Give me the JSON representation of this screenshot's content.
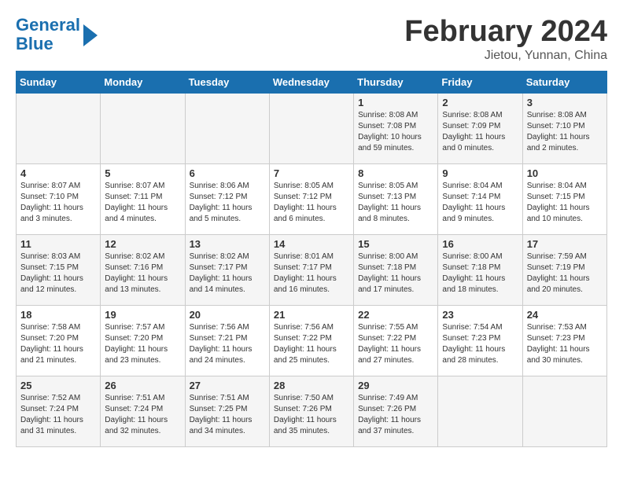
{
  "header": {
    "logo_line1": "General",
    "logo_line2": "Blue",
    "month_title": "February 2024",
    "location": "Jietou, Yunnan, China"
  },
  "days_of_week": [
    "Sunday",
    "Monday",
    "Tuesday",
    "Wednesday",
    "Thursday",
    "Friday",
    "Saturday"
  ],
  "weeks": [
    [
      {
        "day": "",
        "info": ""
      },
      {
        "day": "",
        "info": ""
      },
      {
        "day": "",
        "info": ""
      },
      {
        "day": "",
        "info": ""
      },
      {
        "day": "1",
        "info": "Sunrise: 8:08 AM\nSunset: 7:08 PM\nDaylight: 10 hours\nand 59 minutes."
      },
      {
        "day": "2",
        "info": "Sunrise: 8:08 AM\nSunset: 7:09 PM\nDaylight: 11 hours\nand 0 minutes."
      },
      {
        "day": "3",
        "info": "Sunrise: 8:08 AM\nSunset: 7:10 PM\nDaylight: 11 hours\nand 2 minutes."
      }
    ],
    [
      {
        "day": "4",
        "info": "Sunrise: 8:07 AM\nSunset: 7:10 PM\nDaylight: 11 hours\nand 3 minutes."
      },
      {
        "day": "5",
        "info": "Sunrise: 8:07 AM\nSunset: 7:11 PM\nDaylight: 11 hours\nand 4 minutes."
      },
      {
        "day": "6",
        "info": "Sunrise: 8:06 AM\nSunset: 7:12 PM\nDaylight: 11 hours\nand 5 minutes."
      },
      {
        "day": "7",
        "info": "Sunrise: 8:05 AM\nSunset: 7:12 PM\nDaylight: 11 hours\nand 6 minutes."
      },
      {
        "day": "8",
        "info": "Sunrise: 8:05 AM\nSunset: 7:13 PM\nDaylight: 11 hours\nand 8 minutes."
      },
      {
        "day": "9",
        "info": "Sunrise: 8:04 AM\nSunset: 7:14 PM\nDaylight: 11 hours\nand 9 minutes."
      },
      {
        "day": "10",
        "info": "Sunrise: 8:04 AM\nSunset: 7:15 PM\nDaylight: 11 hours\nand 10 minutes."
      }
    ],
    [
      {
        "day": "11",
        "info": "Sunrise: 8:03 AM\nSunset: 7:15 PM\nDaylight: 11 hours\nand 12 minutes."
      },
      {
        "day": "12",
        "info": "Sunrise: 8:02 AM\nSunset: 7:16 PM\nDaylight: 11 hours\nand 13 minutes."
      },
      {
        "day": "13",
        "info": "Sunrise: 8:02 AM\nSunset: 7:17 PM\nDaylight: 11 hours\nand 14 minutes."
      },
      {
        "day": "14",
        "info": "Sunrise: 8:01 AM\nSunset: 7:17 PM\nDaylight: 11 hours\nand 16 minutes."
      },
      {
        "day": "15",
        "info": "Sunrise: 8:00 AM\nSunset: 7:18 PM\nDaylight: 11 hours\nand 17 minutes."
      },
      {
        "day": "16",
        "info": "Sunrise: 8:00 AM\nSunset: 7:18 PM\nDaylight: 11 hours\nand 18 minutes."
      },
      {
        "day": "17",
        "info": "Sunrise: 7:59 AM\nSunset: 7:19 PM\nDaylight: 11 hours\nand 20 minutes."
      }
    ],
    [
      {
        "day": "18",
        "info": "Sunrise: 7:58 AM\nSunset: 7:20 PM\nDaylight: 11 hours\nand 21 minutes."
      },
      {
        "day": "19",
        "info": "Sunrise: 7:57 AM\nSunset: 7:20 PM\nDaylight: 11 hours\nand 23 minutes."
      },
      {
        "day": "20",
        "info": "Sunrise: 7:56 AM\nSunset: 7:21 PM\nDaylight: 11 hours\nand 24 minutes."
      },
      {
        "day": "21",
        "info": "Sunrise: 7:56 AM\nSunset: 7:22 PM\nDaylight: 11 hours\nand 25 minutes."
      },
      {
        "day": "22",
        "info": "Sunrise: 7:55 AM\nSunset: 7:22 PM\nDaylight: 11 hours\nand 27 minutes."
      },
      {
        "day": "23",
        "info": "Sunrise: 7:54 AM\nSunset: 7:23 PM\nDaylight: 11 hours\nand 28 minutes."
      },
      {
        "day": "24",
        "info": "Sunrise: 7:53 AM\nSunset: 7:23 PM\nDaylight: 11 hours\nand 30 minutes."
      }
    ],
    [
      {
        "day": "25",
        "info": "Sunrise: 7:52 AM\nSunset: 7:24 PM\nDaylight: 11 hours\nand 31 minutes."
      },
      {
        "day": "26",
        "info": "Sunrise: 7:51 AM\nSunset: 7:24 PM\nDaylight: 11 hours\nand 32 minutes."
      },
      {
        "day": "27",
        "info": "Sunrise: 7:51 AM\nSunset: 7:25 PM\nDaylight: 11 hours\nand 34 minutes."
      },
      {
        "day": "28",
        "info": "Sunrise: 7:50 AM\nSunset: 7:26 PM\nDaylight: 11 hours\nand 35 minutes."
      },
      {
        "day": "29",
        "info": "Sunrise: 7:49 AM\nSunset: 7:26 PM\nDaylight: 11 hours\nand 37 minutes."
      },
      {
        "day": "",
        "info": ""
      },
      {
        "day": "",
        "info": ""
      }
    ]
  ]
}
